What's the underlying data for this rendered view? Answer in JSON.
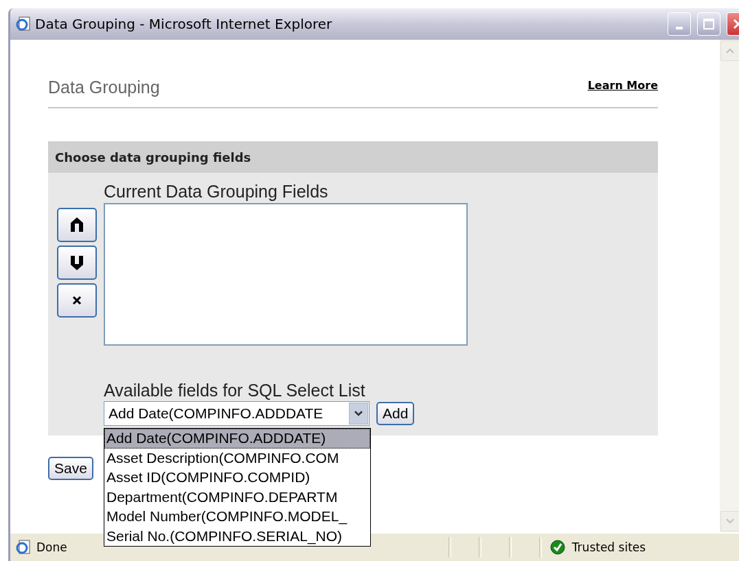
{
  "window": {
    "title": "Data Grouping - Microsoft Internet Explorer"
  },
  "page": {
    "heading": "Data Grouping",
    "learn_more": "Learn More"
  },
  "panel": {
    "title": "Choose data grouping fields",
    "current_label": "Current Data Grouping Fields",
    "available_label": "Available fields for SQL Select List",
    "select_value": "Add Date(COMPINFO.ADDDATE",
    "add_button": "Add",
    "options": [
      {
        "label": "Add Date(COMPINFO.ADDDATE)",
        "selected": true
      },
      {
        "label": "Asset Description(COMPINFO.COM",
        "selected": false
      },
      {
        "label": "Asset ID(COMPINFO.COMPID)",
        "selected": false
      },
      {
        "label": "Department(COMPINFO.DEPARTM",
        "selected": false
      },
      {
        "label": "Model Number(COMPINFO.MODEL_",
        "selected": false
      },
      {
        "label": "Serial No.(COMPINFO.SERIAL_NO)",
        "selected": false
      }
    ]
  },
  "save_button": "Save",
  "status_bar": {
    "status": "Done",
    "zone": "Trusted sites"
  }
}
